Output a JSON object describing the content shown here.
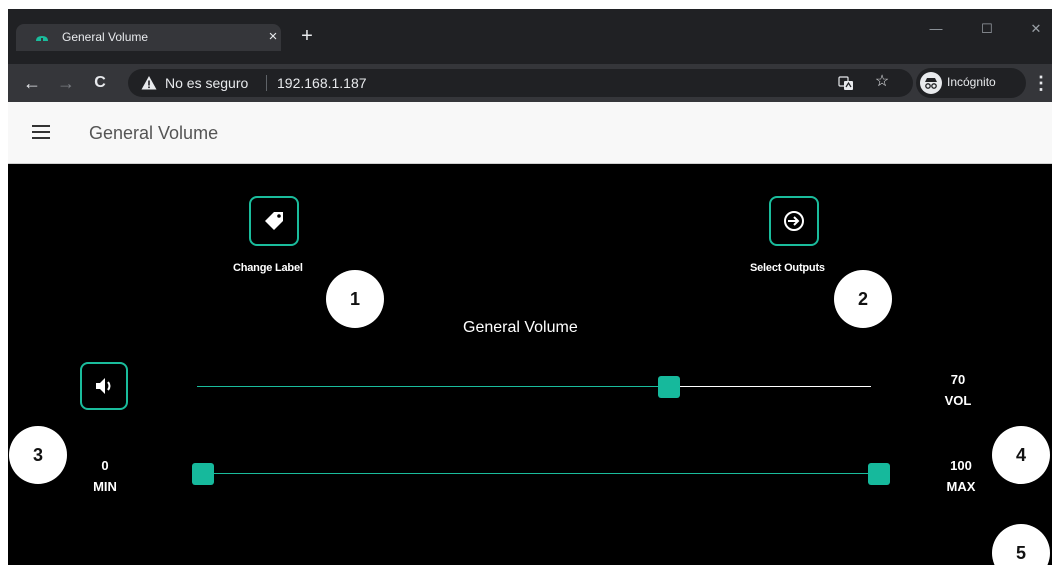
{
  "browser": {
    "tab_title": "General Volume",
    "tab_close": "×",
    "new_tab": "+",
    "window_controls": {
      "minimize": "—",
      "maximize": "☐",
      "close": "✕"
    },
    "nav": {
      "back": "←",
      "forward": "→",
      "reload": "C"
    },
    "security_text": "No es seguro",
    "url": "192.168.1.187",
    "star": "☆",
    "incognito_label": "Incógnito",
    "menu": "⋮"
  },
  "app": {
    "title": "General Volume"
  },
  "panel": {
    "change_label_button": "Change Label",
    "select_outputs_button": "Select Outputs",
    "section_title": "General Volume",
    "volume_value": "70",
    "volume_unit": "VOL",
    "min_value": "0",
    "min_label": "MIN",
    "max_value": "100",
    "max_label": "MAX",
    "volume_level": 70,
    "range_min": 0,
    "range_max": 100
  },
  "callouts": [
    "1",
    "2",
    "3",
    "4",
    "5"
  ],
  "colors": {
    "accent": "#1abc9c",
    "browser_dark": "#202124",
    "browser_toolbar": "#35363a",
    "app_header_bg": "#f8f8f8",
    "content_bg": "#000000"
  },
  "icons": {
    "tab_favicon": "cloud-icon",
    "security": "warning-icon",
    "translate": "translate-icon",
    "bookmark": "star-icon",
    "incognito": "incognito-icon",
    "menu": "hamburger-icon",
    "change_label": "tag-icon",
    "select_outputs": "sign-in-arrow-icon",
    "volume": "speaker-icon"
  }
}
